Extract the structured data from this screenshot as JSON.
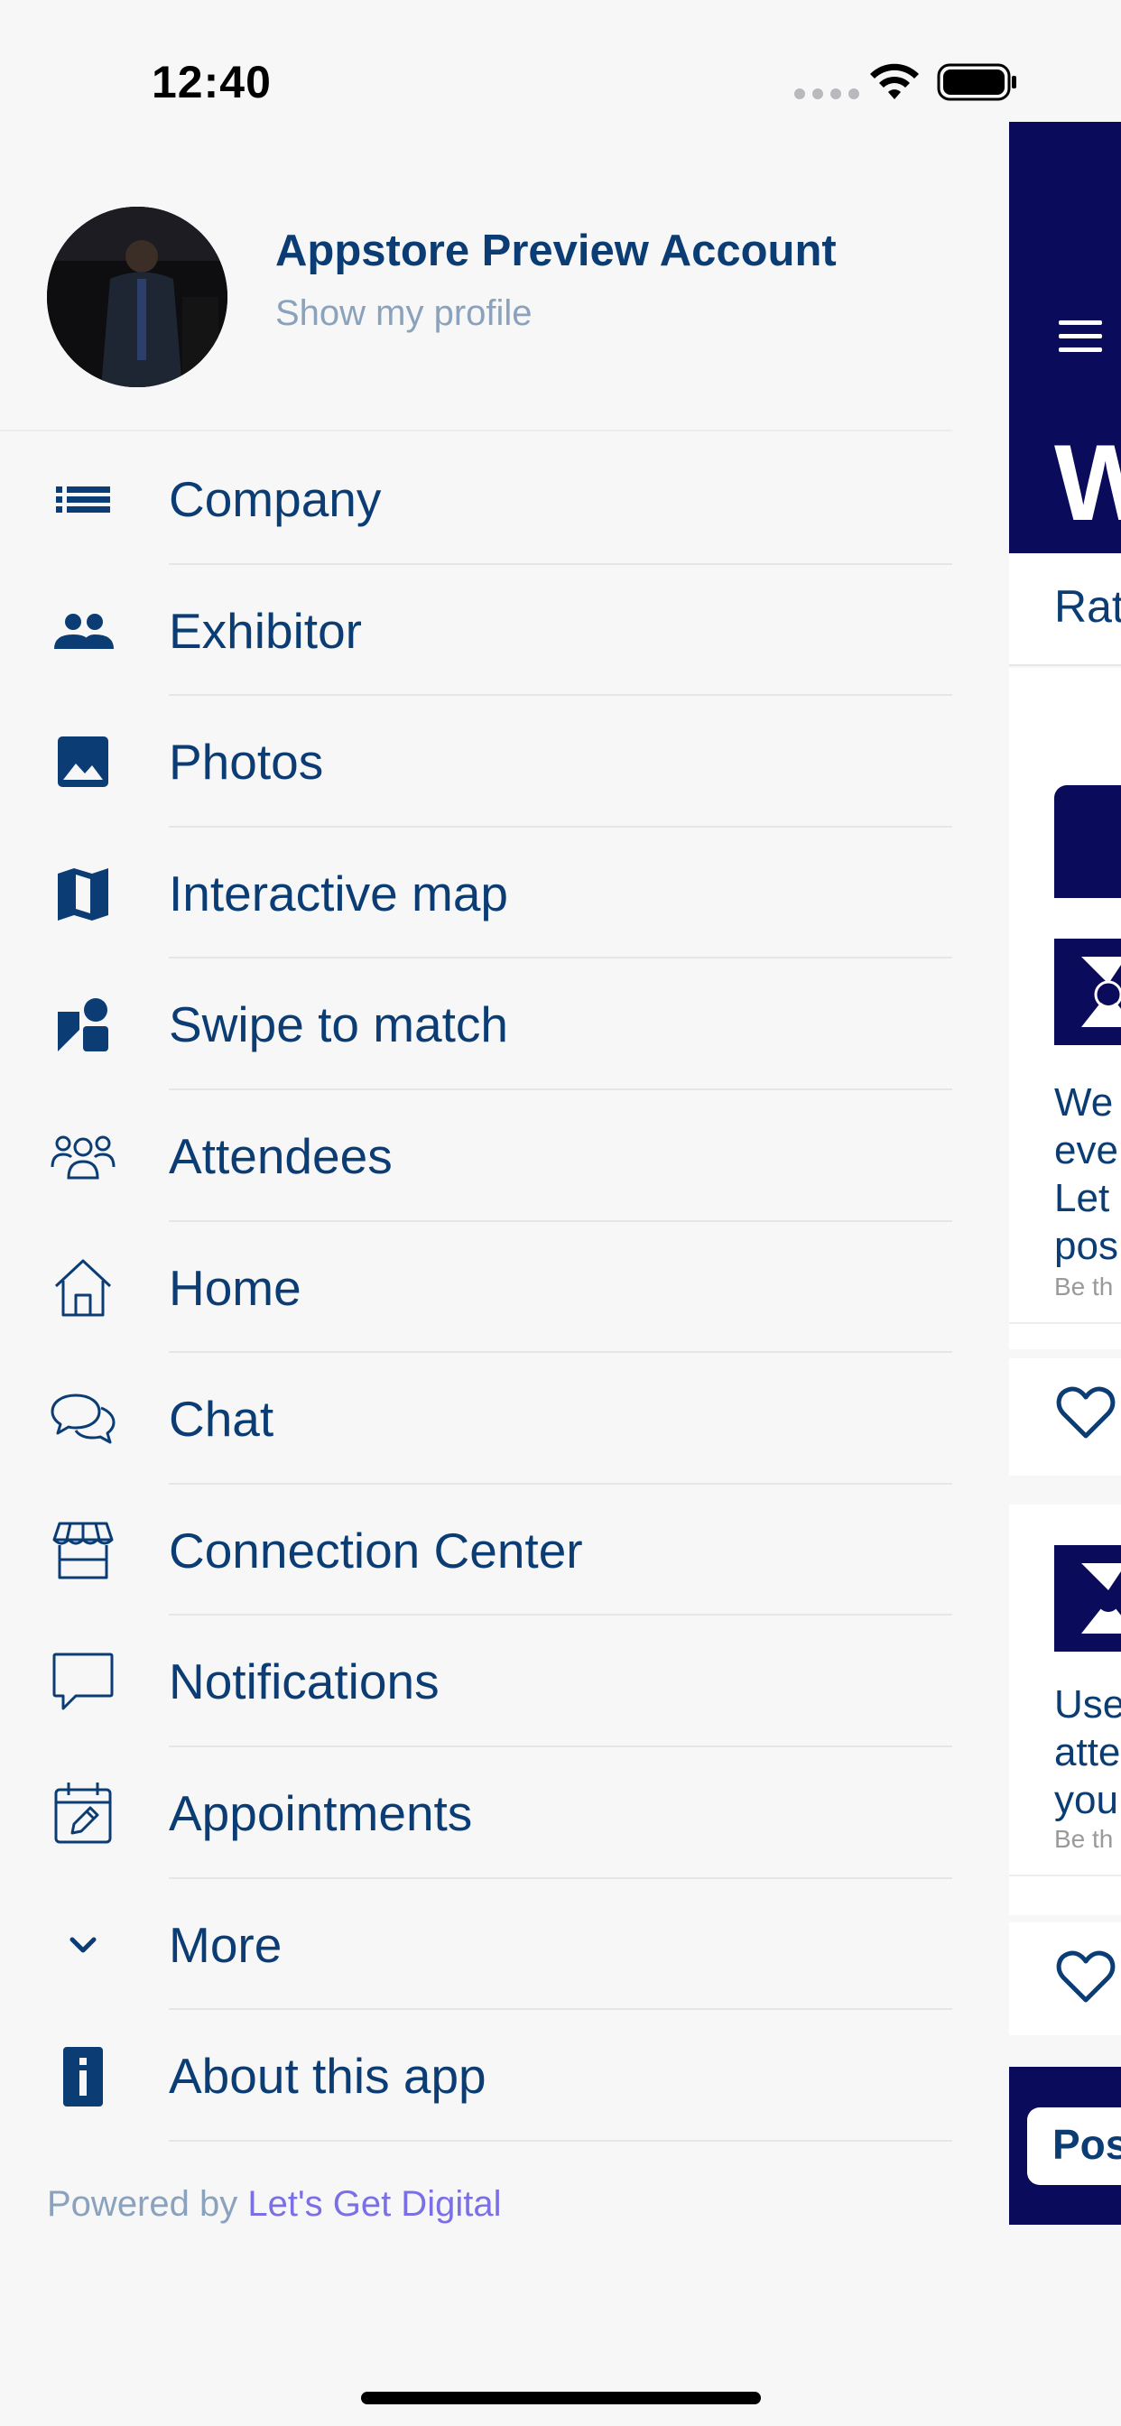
{
  "status_bar": {
    "time": "12:40"
  },
  "profile": {
    "name": "Appstore Preview Account",
    "subtitle": "Show my profile"
  },
  "menu": {
    "items": [
      {
        "label": "Company",
        "icon": "list-icon"
      },
      {
        "label": "Exhibitor",
        "icon": "people-icon"
      },
      {
        "label": "Photos",
        "icon": "image-icon"
      },
      {
        "label": "Interactive map",
        "icon": "map-icon"
      },
      {
        "label": "Swipe to match",
        "icon": "shapes-icon"
      },
      {
        "label": "Attendees",
        "icon": "group-icon"
      },
      {
        "label": "Home",
        "icon": "home-icon"
      },
      {
        "label": "Chat",
        "icon": "chat-bubbles-icon"
      },
      {
        "label": "Connection Center",
        "icon": "storefront-icon"
      },
      {
        "label": "Notifications",
        "icon": "speech-bubble-icon"
      },
      {
        "label": "Appointments",
        "icon": "calendar-edit-icon"
      },
      {
        "label": "More",
        "icon": "chevron-down-icon"
      },
      {
        "label": "About this app",
        "icon": "info-icon"
      }
    ]
  },
  "footer": {
    "powered_prefix": "Powered by",
    "powered_link": "Let's Get Digital"
  },
  "peek": {
    "title_fragment": "W",
    "rate_fragment": "Rat",
    "card1": {
      "lines": [
        "We",
        "ever",
        "Let",
        "pos"
      ],
      "small": "Be th"
    },
    "card2": {
      "lines": [
        "Use",
        "atte",
        "you"
      ],
      "small": "Be th"
    },
    "footer_fragment": "Pos"
  },
  "colors": {
    "primary": "#0b3d74",
    "navy": "#0b0b5b",
    "muted": "#8aa2bb",
    "link": "#7b6fe6",
    "background": "#f7f7f8"
  }
}
